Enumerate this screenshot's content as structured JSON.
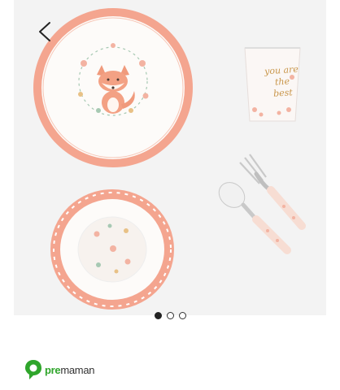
{
  "gallery": {
    "cup_text": [
      "you are",
      "the",
      "best"
    ],
    "slide_count": 3,
    "active_slide": 1
  },
  "brand": {
    "name_prefix": "pre",
    "name_suffix": "maman",
    "color": "#2fa52b"
  },
  "colors": {
    "accent_coral": "#f2a48e",
    "gold": "#c9964a"
  },
  "icons": {
    "back": "chevron-left-icon",
    "logo": "premaman-logo-icon"
  }
}
